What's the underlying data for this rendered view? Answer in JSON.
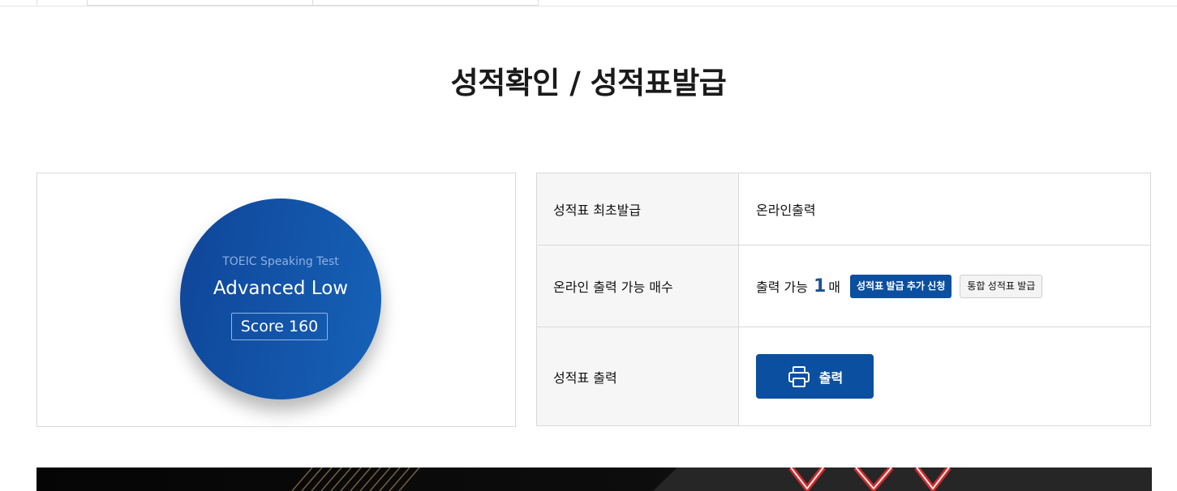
{
  "page": {
    "title": "성적확인 / 성적표발급"
  },
  "score": {
    "test_name": "TOEIC Speaking Test",
    "level": "Advanced Low",
    "score_text": "Score 160"
  },
  "info_table": {
    "rows": [
      {
        "label": "성적표 최초발급",
        "value": "온라인출력"
      },
      {
        "label": "온라인 출력 가능 매수",
        "prefix": "출력 가능",
        "count": "1",
        "unit": "매",
        "add_request_button": "성적표 발급 추가 신청",
        "integrated_button": "통합 성적표 발급"
      },
      {
        "label": "성적표 출력",
        "print_button": "출력"
      }
    ]
  },
  "colors": {
    "accent": "#0b4fa0",
    "circle_start": "#0f4598",
    "circle_end": "#1662b8",
    "count_number": "#1c4f97"
  },
  "icons": {
    "print": "printer-icon"
  }
}
